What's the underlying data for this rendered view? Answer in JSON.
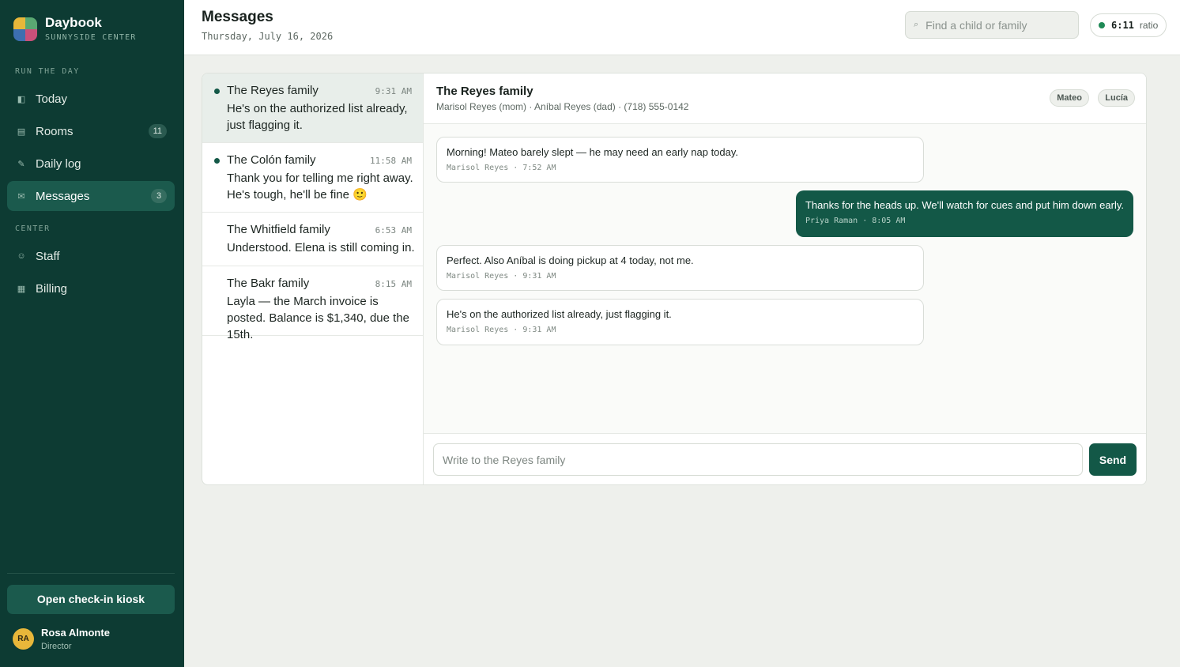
{
  "app": {
    "name": "Daybook",
    "center": "SUNNYSIDE CENTER",
    "logo_colors": [
      "#e8b73a",
      "#5aa872",
      "#3c6fb0",
      "#c9507a"
    ]
  },
  "sidebar": {
    "section_run": "RUN THE DAY",
    "section_center": "CENTER",
    "items": [
      {
        "label": "Today",
        "icon": "panel-icon",
        "glyph": "◧"
      },
      {
        "label": "Rooms",
        "icon": "rooms-icon",
        "glyph": "▤",
        "badge": "11"
      },
      {
        "label": "Daily log",
        "icon": "pencil-icon",
        "glyph": "✎"
      },
      {
        "label": "Messages",
        "icon": "envelope-icon",
        "glyph": "✉",
        "badge": "3",
        "active": true
      },
      {
        "label": "Staff",
        "icon": "staff-icon",
        "glyph": "☺"
      },
      {
        "label": "Billing",
        "icon": "billing-icon",
        "glyph": "▦"
      }
    ],
    "kiosk_button": "Open check-in kiosk",
    "user": {
      "initials": "RA",
      "name": "Rosa Almonte",
      "role": "Director"
    }
  },
  "header": {
    "title": "Messages",
    "date": "Thursday, July 16, 2026",
    "search_placeholder": "Find a child or family",
    "ratio_value": "6:11",
    "ratio_label": "ratio",
    "ratio_status_color": "#1f8a56"
  },
  "threads": [
    {
      "name": "The Reyes family",
      "time": "9:31 AM",
      "preview": "He's on the authorized list already, just flagging it.",
      "unread": true,
      "selected": true
    },
    {
      "name": "The Colón family",
      "time": "11:58 AM",
      "preview": "Thank you for telling me right away. He's tough, he'll be fine 🙂",
      "unread": true
    },
    {
      "name": "The Whitfield family",
      "time": "6:53 AM",
      "preview": "Understood. Elena is still coming in.",
      "unread": false
    },
    {
      "name": "The Bakr family",
      "time": "8:15 AM",
      "preview": "Layla — the March invoice is posted. Balance is $1,340, due the 15th.",
      "unread": false
    }
  ],
  "conversation": {
    "title": "The Reyes family",
    "subtitle": "Marisol Reyes (mom) · Aníbal Reyes (dad) · (718) 555-0142",
    "children": [
      "Mateo",
      "Lucía"
    ],
    "messages": [
      {
        "direction": "in",
        "text": "Morning! Mateo barely slept — he may need an early nap today.",
        "meta": "Marisol Reyes · 7:52 AM"
      },
      {
        "direction": "out",
        "text": "Thanks for the heads up. We'll watch for cues and put him down early.",
        "meta": "Priya Raman · 8:05 AM"
      },
      {
        "direction": "in",
        "text": "Perfect. Also Aníbal is doing pickup at 4 today, not me.",
        "meta": "Marisol Reyes · 9:31 AM"
      },
      {
        "direction": "in",
        "text": "He's on the authorized list already, just flagging it.",
        "meta": "Marisol Reyes · 9:31 AM"
      }
    ],
    "composer_placeholder": "Write to the Reyes family",
    "send_label": "Send"
  },
  "colors": {
    "sidebar": "#0d3b33",
    "accent": "#135847",
    "active_nav": "#1b5a4d"
  }
}
